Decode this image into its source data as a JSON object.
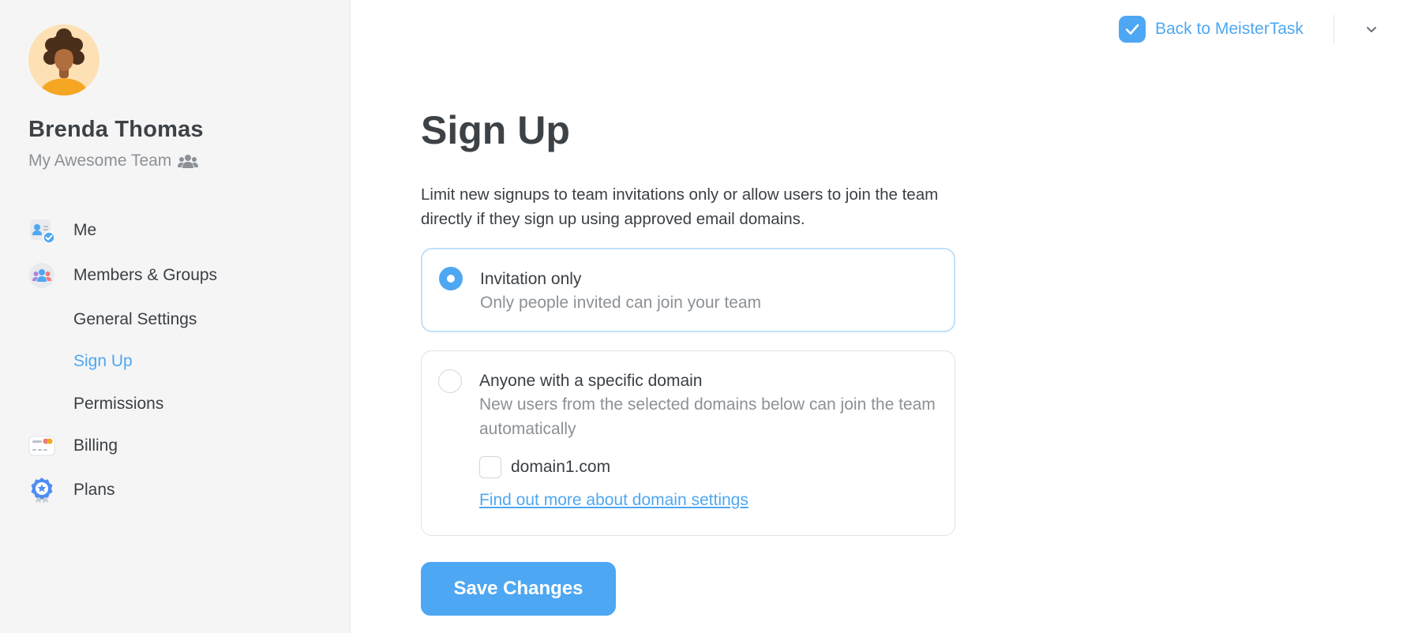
{
  "user": {
    "name": "Brenda Thomas",
    "team": "My Awesome Team",
    "avatar_icon": "avatar-woman-curly-hair"
  },
  "sidebar": {
    "items": [
      {
        "label": "Me",
        "icon": "user-badge-icon"
      },
      {
        "label": "Members & Groups",
        "icon": "members-icon"
      },
      {
        "label": "General Settings"
      },
      {
        "label": "Sign Up",
        "active": true
      },
      {
        "label": "Permissions"
      },
      {
        "label": "Billing",
        "icon": "credit-card-icon"
      },
      {
        "label": "Plans",
        "icon": "plans-badge-icon"
      }
    ]
  },
  "header": {
    "back_label": "Back to MeisterTask",
    "back_icon": "checkmark-icon",
    "dropdown_icon": "chevron-down-icon"
  },
  "main": {
    "title": "Sign Up",
    "description": "Limit new signups to team invitations only or allow users to join the team directly if they sign up using approved email domains.",
    "options": [
      {
        "title": "Invitation only",
        "subtitle": "Only people invited can join your team",
        "selected": true
      },
      {
        "title": "Anyone with a specific domain",
        "subtitle": "New users from the selected domains below can join the team automatically",
        "selected": false,
        "domains": [
          {
            "name": "domain1.com",
            "checked": false
          }
        ],
        "help_link": "Find out more about domain settings"
      }
    ],
    "save_label": "Save Changes"
  },
  "colors": {
    "accent": "#4ea7f2",
    "sidebar_bg": "#f5f5f6",
    "muted_text": "#8c9196",
    "selected_border": "#bfe1fb"
  }
}
